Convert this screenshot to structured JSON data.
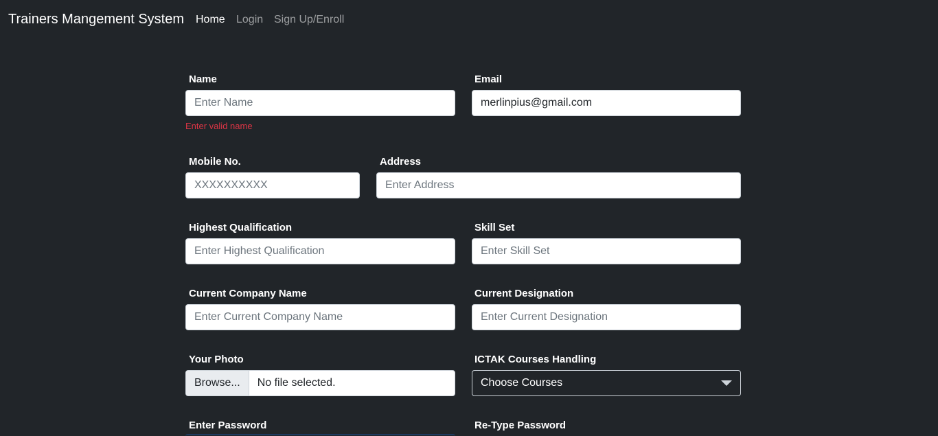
{
  "navbar": {
    "brand": "Trainers Mangement System",
    "links": [
      {
        "label": "Home",
        "active": true
      },
      {
        "label": "Login",
        "active": false
      },
      {
        "label": "Sign Up/Enroll",
        "active": false
      }
    ]
  },
  "form": {
    "name": {
      "label": "Name",
      "placeholder": "Enter Name",
      "value": "",
      "error": "Enter valid name"
    },
    "email": {
      "label": "Email",
      "placeholder": "",
      "value": "merlinpius@gmail.com"
    },
    "mobile": {
      "label": "Mobile No.",
      "placeholder": "XXXXXXXXXX",
      "value": ""
    },
    "address": {
      "label": "Address",
      "placeholder": "Enter Address",
      "value": ""
    },
    "qualification": {
      "label": "Highest Qualification",
      "placeholder": "Enter Highest Qualification",
      "value": ""
    },
    "skills": {
      "label": "Skill Set",
      "placeholder": "Enter Skill Set",
      "value": ""
    },
    "company": {
      "label": "Current Company Name",
      "placeholder": "Enter Current Company Name",
      "value": ""
    },
    "designation": {
      "label": "Current Designation",
      "placeholder": "Enter Current Designation",
      "value": ""
    },
    "photo": {
      "label": "Your Photo",
      "button": "Browse...",
      "status": "No file selected."
    },
    "courses": {
      "label": "ICTAK Courses Handling",
      "selected": "Choose Courses"
    },
    "password": {
      "label": "Enter Password"
    },
    "retype_password": {
      "label": "Re-Type Password"
    }
  },
  "colors": {
    "background": "#212529",
    "error": "#dc3545",
    "input_border": "#ced4da"
  }
}
